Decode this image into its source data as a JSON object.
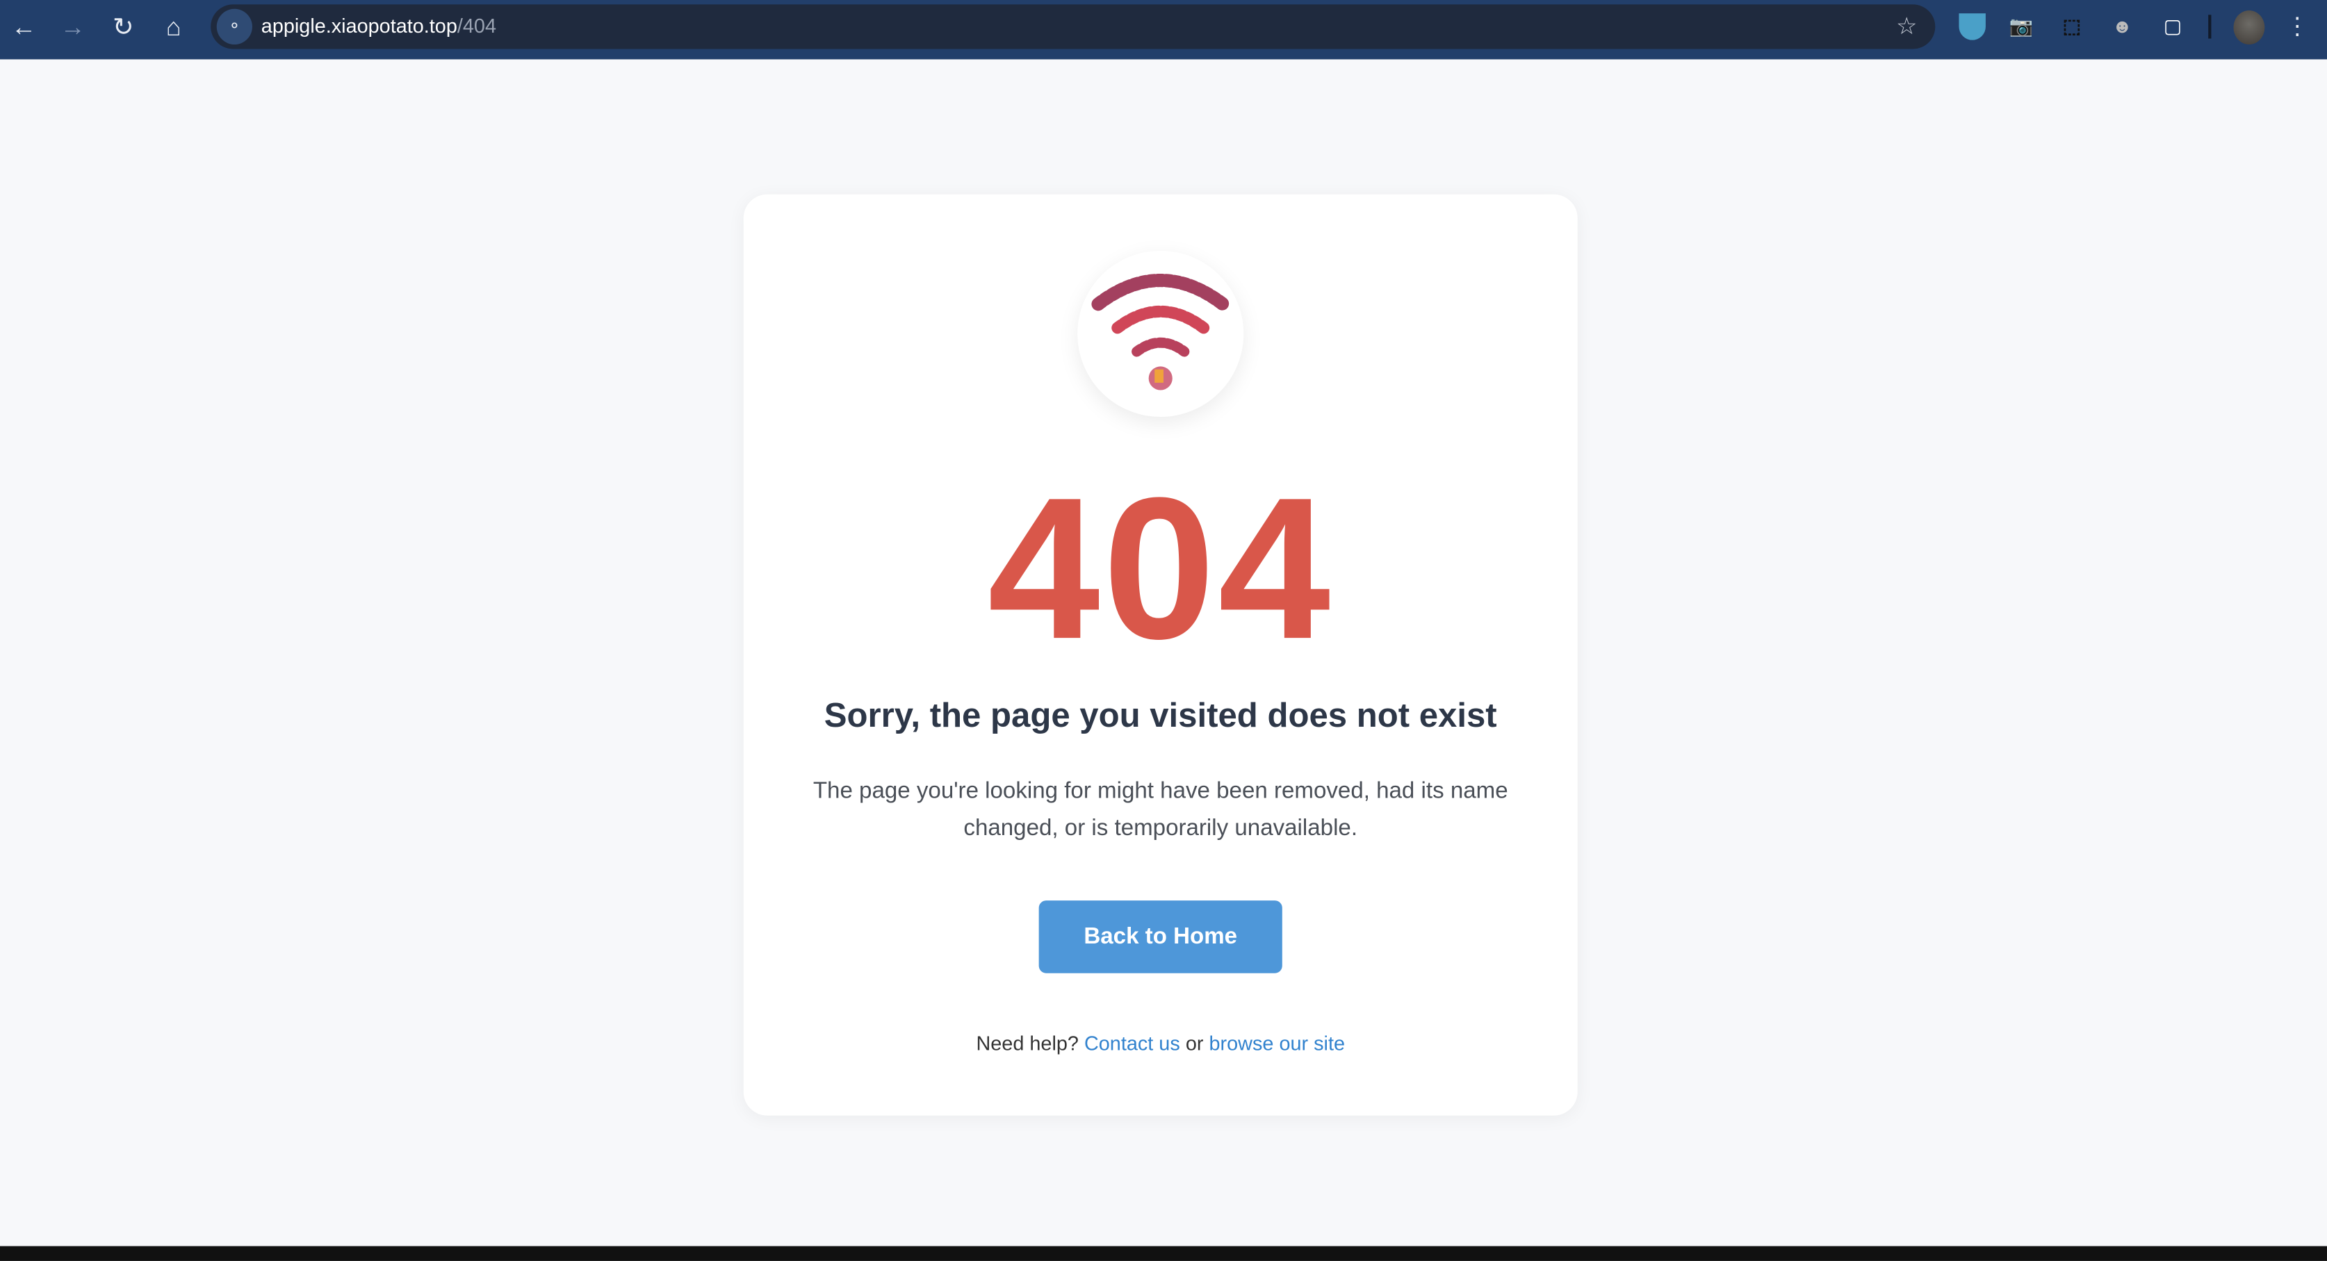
{
  "browser": {
    "url_host": "appigle.xiaopotato.top",
    "url_path": "/404",
    "icons": [
      "back-icon",
      "forward-icon",
      "reload-icon",
      "home-icon",
      "site-info-icon",
      "bookmark-star-icon",
      "extension-fruit-bowl-icon",
      "extension-camera-icon",
      "extension-screenshot-icon",
      "extension-monkey-icon",
      "extensions-puzzle-icon",
      "profile-avatar",
      "more-menu-icon"
    ]
  },
  "page": {
    "code": "404",
    "title": "Sorry, the page you visited does not exist",
    "description": "The page you're looking for might have been removed, had its name changed, or is temporarily unavailable.",
    "button": "Back to Home",
    "help_prefix": "Need help?",
    "contact_link": "Contact us",
    "help_or": "or",
    "browse_link": "browse our site"
  },
  "colors": {
    "accent": "#4e97d9",
    "error": "#d9574a",
    "toolbar": "#223f6b"
  }
}
